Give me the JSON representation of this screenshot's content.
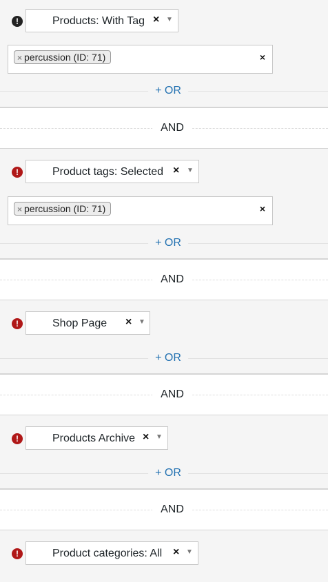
{
  "groups": [
    {
      "warning_icon": "exclamation-circle-icon",
      "warning_color": "#222222",
      "rule_label": "Products: With Tag",
      "clear_label": "×",
      "values": [
        {
          "label": "percussion (ID: 71)",
          "remove": "×"
        }
      ],
      "values_clear": "×",
      "or_label": "+ OR"
    },
    {
      "warning_icon": "exclamation-circle-icon",
      "warning_color": "#b01818",
      "rule_label": "Product tags: Selected",
      "clear_label": "×",
      "values": [
        {
          "label": "percussion (ID: 71)",
          "remove": "×"
        }
      ],
      "values_clear": "×",
      "or_label": "+ OR"
    },
    {
      "warning_icon": "exclamation-circle-icon",
      "warning_color": "#b01818",
      "rule_label": "Shop Page",
      "clear_label": "×",
      "or_label": "+ OR"
    },
    {
      "warning_icon": "exclamation-circle-icon",
      "warning_color": "#b01818",
      "rule_label": "Products Archive",
      "clear_label": "×",
      "or_label": "+ OR"
    },
    {
      "warning_icon": "exclamation-circle-icon",
      "warning_color": "#b01818",
      "rule_label": "Product categories: All",
      "clear_label": "×"
    }
  ],
  "and_label": "AND",
  "warning_glyph": "!",
  "caret_glyph": "▼",
  "colors": {
    "accent": "#2271b1",
    "warning_red": "#b01818",
    "background": "#f5f5f5"
  }
}
